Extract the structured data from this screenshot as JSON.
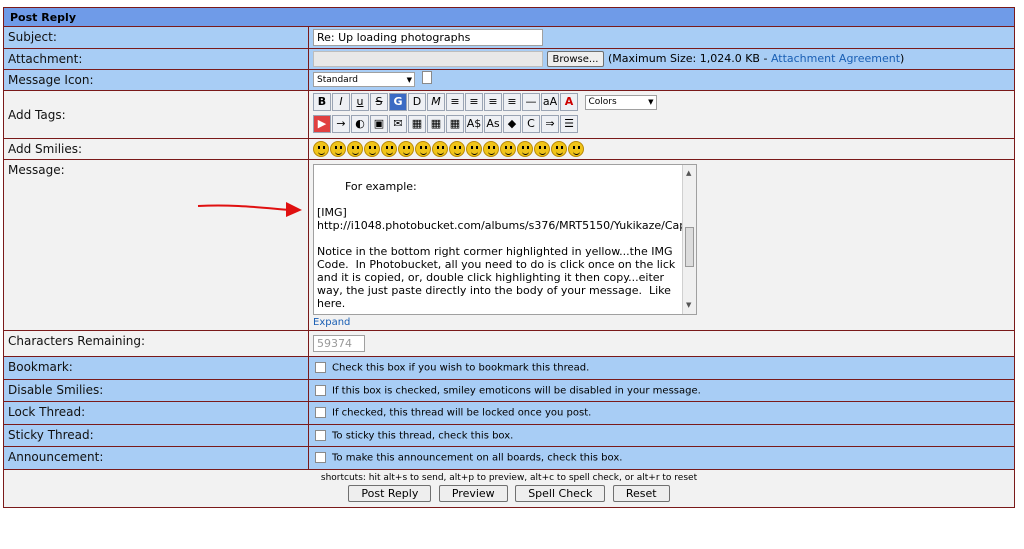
{
  "title": "Post Reply",
  "labels": {
    "subject": "Subject:",
    "attachment": "Attachment:",
    "icon": "Message Icon:",
    "tags": "Add Tags:",
    "smilies": "Add Smilies:",
    "message": "Message:",
    "chars": "Characters Remaining:",
    "bookmark": "Bookmark:",
    "disable": "Disable Smilies:",
    "lock": "Lock Thread:",
    "sticky": "Sticky Thread:",
    "announce": "Announcement:"
  },
  "subject_value": "Re: Up loading photographs",
  "browse_label": "Browse...",
  "max_size_text": "(Maximum Size: 1,024.0 KB - ",
  "attachment_link": "Attachment Agreement",
  "max_size_close": ")",
  "icon_select": "Standard",
  "colors_select": "Colors",
  "message_text": "For example:\n\n[IMG]\nhttp://i1048.photobucket.com/albums/s376/MRT5150/Yukikaze/Capture.jpg[/IMG]\n\nNotice in the bottom right cormer highlighted in yellow...the IMG Code.  In Photobucket, all you need to do is click once on the lick and it is copied, or, double click highlighting it then copy...eiter way, the just paste directly into the body of your message.  Like here.",
  "expand": "Expand",
  "chars_remaining": "59374",
  "bookmark_text": "Check this box if you wish to bookmark this thread.",
  "disable_text": "If this box is checked, smiley emoticons will be disabled in your message.",
  "lock_text": "If checked, this thread will be locked once you post.",
  "sticky_text": "To sticky this thread, check this box.",
  "announce_text": "To make this announcement on all boards, check this box.",
  "shortcuts": "shortcuts: hit alt+s to send, alt+p to preview, alt+c to spell check, or alt+r to reset",
  "buttons": {
    "post": "Post Reply",
    "preview": "Preview",
    "spell": "Spell Check",
    "reset": "Reset"
  },
  "toolbar_row1": [
    "B",
    "I",
    "u",
    "S",
    "G",
    "D",
    "M",
    "≡",
    "≡",
    "≡",
    "≡",
    "—",
    "aA",
    "A"
  ],
  "toolbar_row2": [
    "▶",
    "→",
    "◐",
    "▣",
    "✉",
    "▦",
    "▦",
    "▦",
    "A$",
    "As",
    "◆",
    "C",
    "⇒",
    "☰"
  ],
  "annotation_color": "#e01010"
}
